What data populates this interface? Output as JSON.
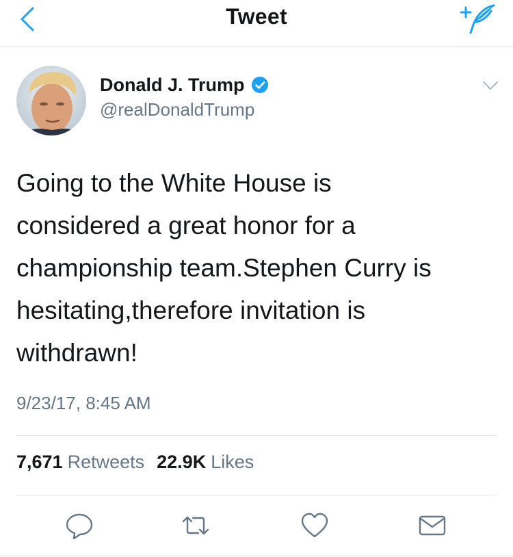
{
  "nav": {
    "title": "Tweet",
    "back_icon": "chevron-left-icon",
    "compose_icon": "compose-tweet-icon"
  },
  "tweet": {
    "author_name": "Donald J. Trump",
    "handle": "@realDonaldTrump",
    "verified": true,
    "text": "Going to the White House is\nconsidered a great honor for a\nchampionship team.Stephen Curry is\nhesitating,therefore invitation is\nwithdrawn!",
    "timestamp": "9/23/17, 8:45 AM",
    "retweets_count": "7,671",
    "retweets_label": "Retweets",
    "likes_count": "22.9K",
    "likes_label": "Likes"
  },
  "actions": [
    {
      "icon": "reply-icon"
    },
    {
      "icon": "retweet-icon"
    },
    {
      "icon": "like-icon"
    },
    {
      "icon": "direct-message-icon"
    }
  ],
  "colors": {
    "accent": "#1da1f2",
    "text": "#14171a",
    "secondary": "#657786",
    "divider": "#e1e8ed"
  }
}
